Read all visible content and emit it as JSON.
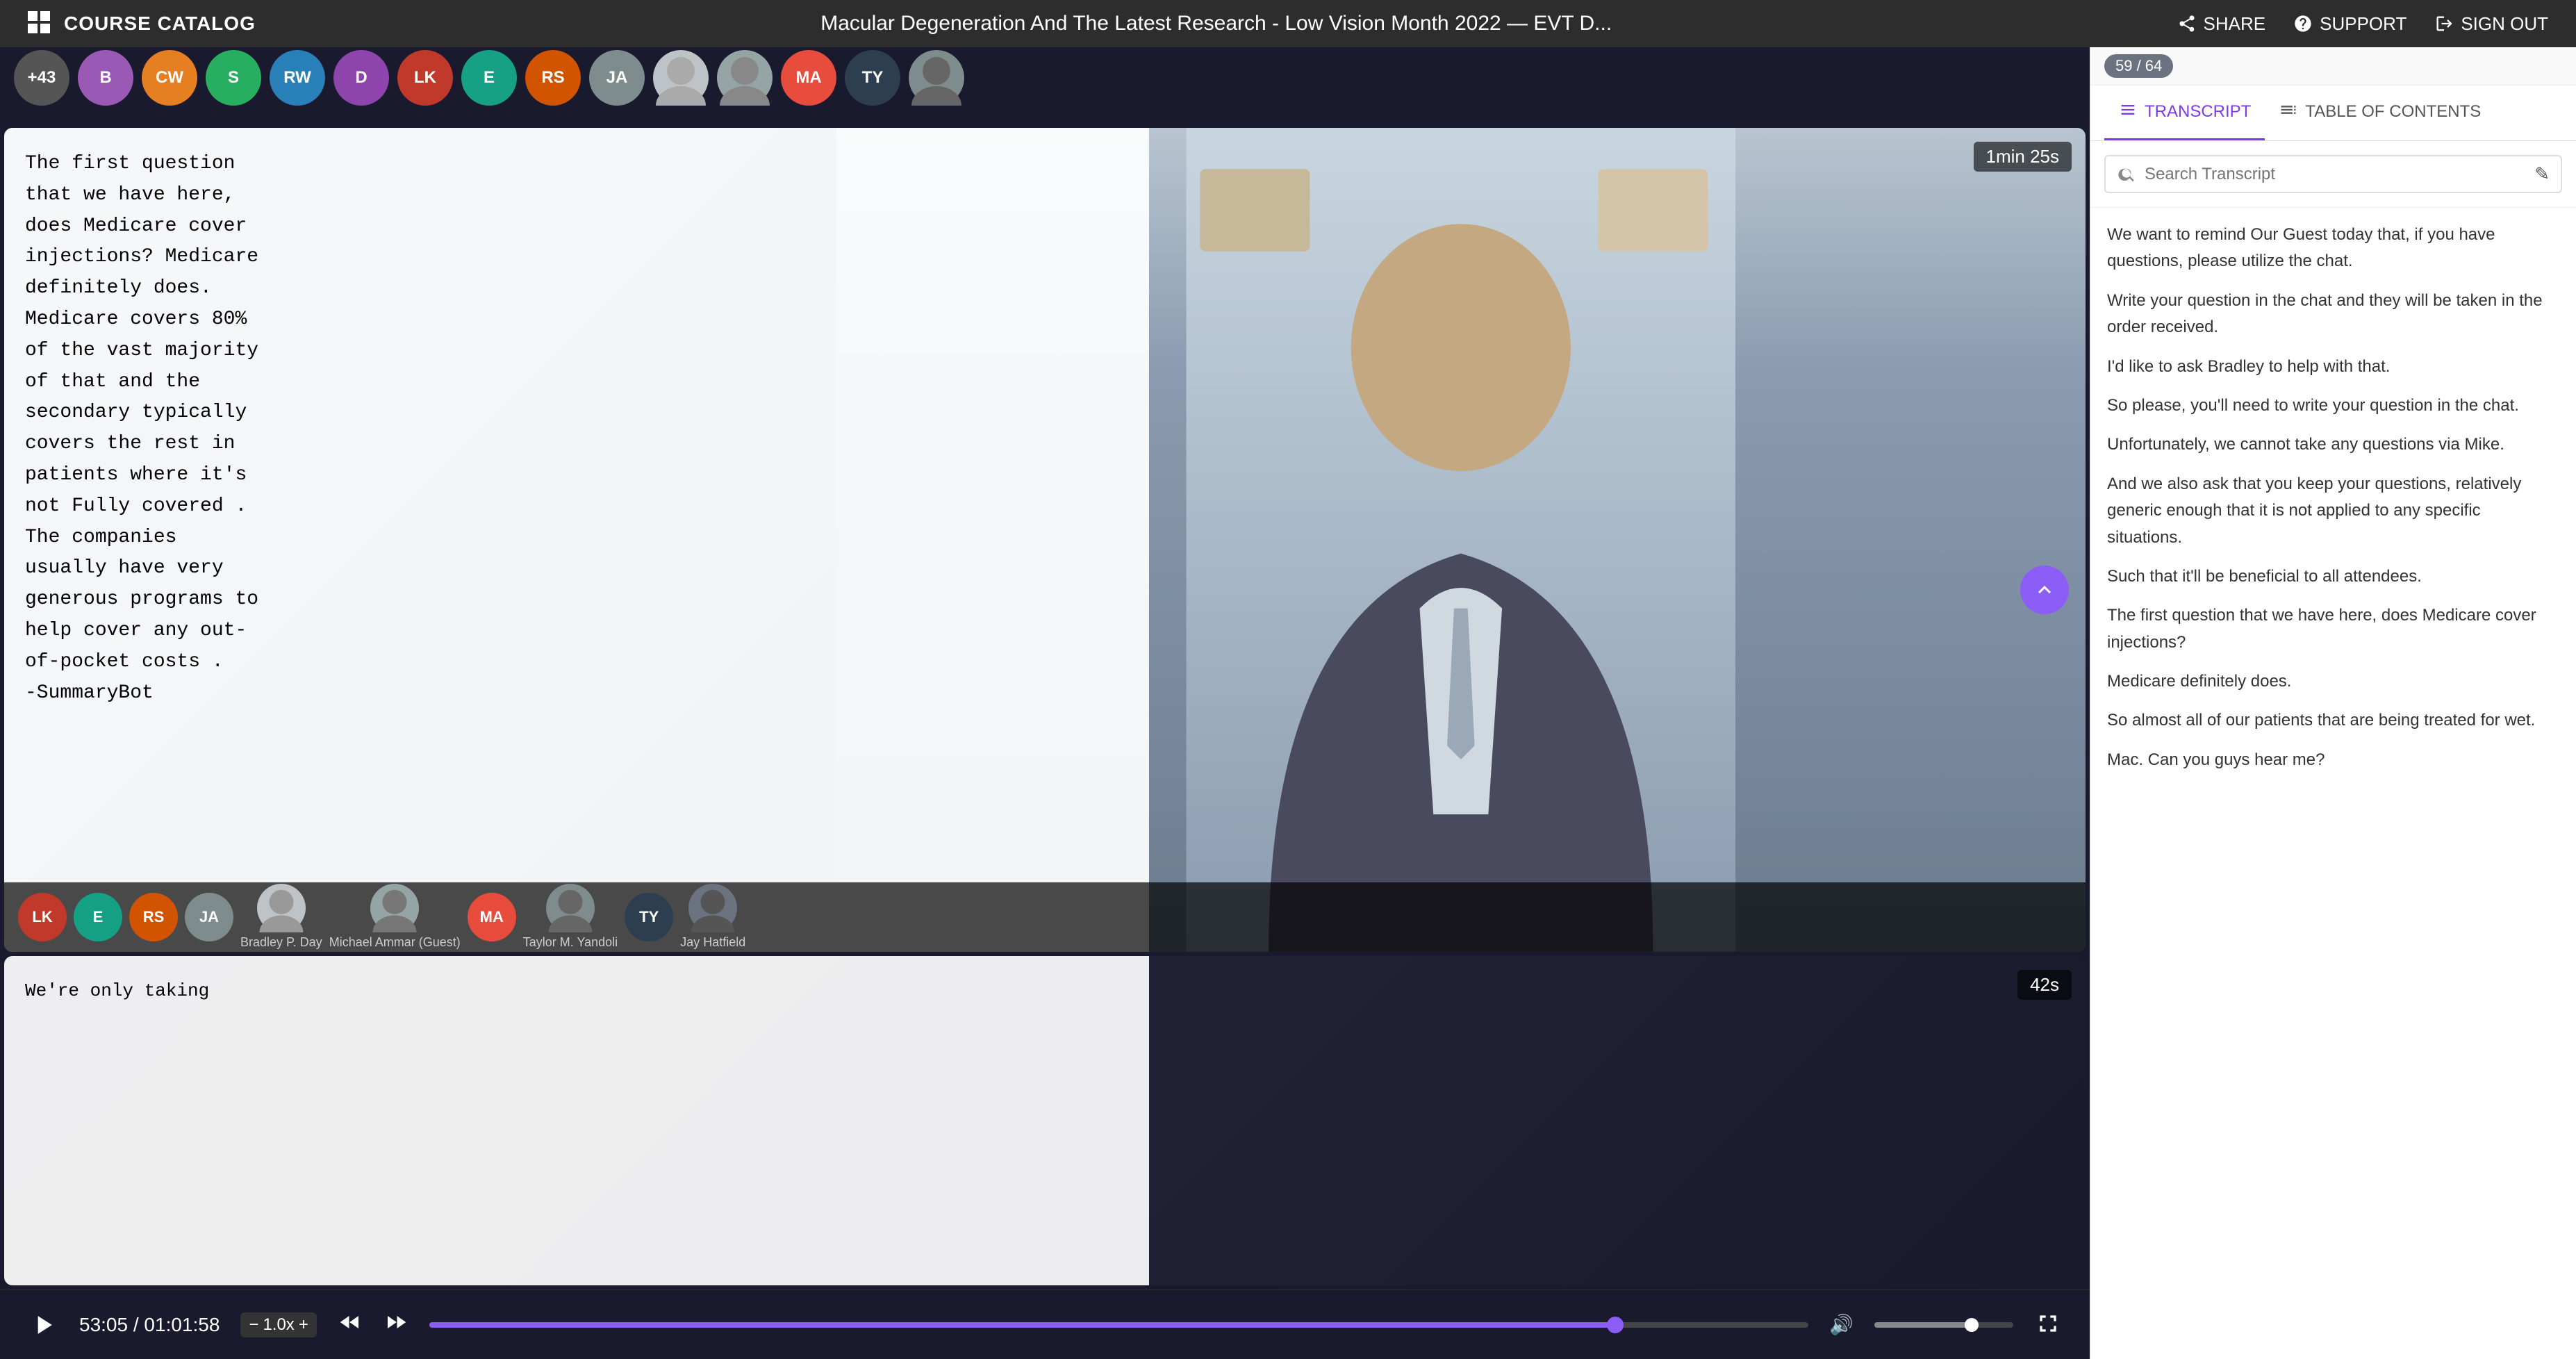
{
  "topBar": {
    "logoIcon": "grid-icon",
    "catalogLabel": "COURSE CATALOG",
    "title": "Macular Degeneration And The Latest Research - Low Vision Month 2022 — EVT D...",
    "shareLabel": "SHARE",
    "supportLabel": "SUPPORT",
    "signOutLabel": "SIGN OUT"
  },
  "participants": [
    {
      "id": "p1",
      "initials": "+43",
      "color": "#555"
    },
    {
      "id": "p2",
      "initials": "B",
      "color": "#9b59b6"
    },
    {
      "id": "p3",
      "initials": "CW",
      "color": "#e67e22"
    },
    {
      "id": "p4",
      "initials": "S",
      "color": "#27ae60"
    },
    {
      "id": "p5",
      "initials": "RW",
      "color": "#2980b9"
    },
    {
      "id": "p6",
      "initials": "D",
      "color": "#8e44ad"
    },
    {
      "id": "p7",
      "initials": "LK",
      "color": "#c0392b"
    },
    {
      "id": "p8",
      "initials": "E",
      "color": "#16a085"
    },
    {
      "id": "p9",
      "initials": "RS",
      "color": "#d35400"
    },
    {
      "id": "p10",
      "initials": "JA",
      "color": "#7f8c8d"
    },
    {
      "id": "p11",
      "initials": "photo1",
      "color": "#bdc3c7"
    },
    {
      "id": "p12",
      "initials": "photo2",
      "color": "#95a5a6"
    },
    {
      "id": "p13",
      "initials": "MA",
      "color": "#e74c3c"
    },
    {
      "id": "p14",
      "initials": "TY",
      "color": "#2c3e50"
    },
    {
      "id": "p15",
      "initials": "photo3",
      "color": "#7f8c8d"
    }
  ],
  "mainVideo": {
    "timer": "1min 25s",
    "caption": "The first question\nthat we have here,\ndoes Medicare cover\ninjections? Medicare\ndefinitely does.\nMedicare covers 80%\nof the vast majority\nof that and the\nsecondary typically\ncovers the rest in\npatients where it's\nnot Fully covered .\nThe companies\nusually have very\ngenerous programs to\nhelp cover any out-\nof-pocket costs .\n-SummaryBot",
    "bottomAvatars": [
      {
        "initials": "LK",
        "color": "#c0392b",
        "name": ""
      },
      {
        "initials": "E",
        "color": "#16a085",
        "name": ""
      },
      {
        "initials": "RS",
        "color": "#d35400",
        "name": ""
      },
      {
        "initials": "JA",
        "color": "#7f8c8d",
        "name": ""
      },
      {
        "initials": "photo1",
        "color": "#bdc3c7",
        "name": "Bradley P. Day"
      },
      {
        "initials": "photo2",
        "color": "#95a5a6",
        "name": "Michael Ammar (Guest)"
      },
      {
        "initials": "MA",
        "color": "#e74c3c",
        "name": ""
      },
      {
        "initials": "photo3",
        "color": "#7f8c8d",
        "name": "Taylor M. Yandoli"
      },
      {
        "initials": "TY",
        "color": "#2c3e50",
        "name": ""
      },
      {
        "initials": "photo4",
        "color": "#6b7280",
        "name": "Jay Hatfield"
      }
    ]
  },
  "smallVideo": {
    "timer": "42s",
    "caption": "We're only taking"
  },
  "controls": {
    "currentTime": "53:05",
    "totalTime": "01:01:58",
    "speed": "1.0x",
    "progressPercent": 86,
    "thumbPercent": 86
  },
  "rightPanel": {
    "slideCounter": "59 / 64",
    "tabs": [
      {
        "id": "transcript",
        "label": "TRANSCRIPT",
        "icon": "≡",
        "active": true
      },
      {
        "id": "toc",
        "label": "TABLE OF CONTENTS",
        "icon": "☰",
        "active": false
      }
    ],
    "search": {
      "placeholder": "Search Transcript"
    },
    "editIcon": "✎",
    "transcriptLines": [
      "We want to remind Our Guest today that, if you have questions, please utilize the chat.",
      "Write your question in the chat and they will be taken in the order received.",
      "I'd like to ask Bradley to help with that.",
      "So please, you'll need to write your question in the chat.",
      "Unfortunately, we cannot take any questions via Mike.",
      "And we also ask that you keep your questions, relatively generic enough that it is not applied to any specific situations.",
      "Such that it'll be beneficial to all attendees.",
      "The first question that we have here, does Medicare cover injections?",
      "Medicare definitely does.",
      "So almost all of our patients that are being treated for wet.",
      "Mac. Can you guys hear me?"
    ]
  }
}
